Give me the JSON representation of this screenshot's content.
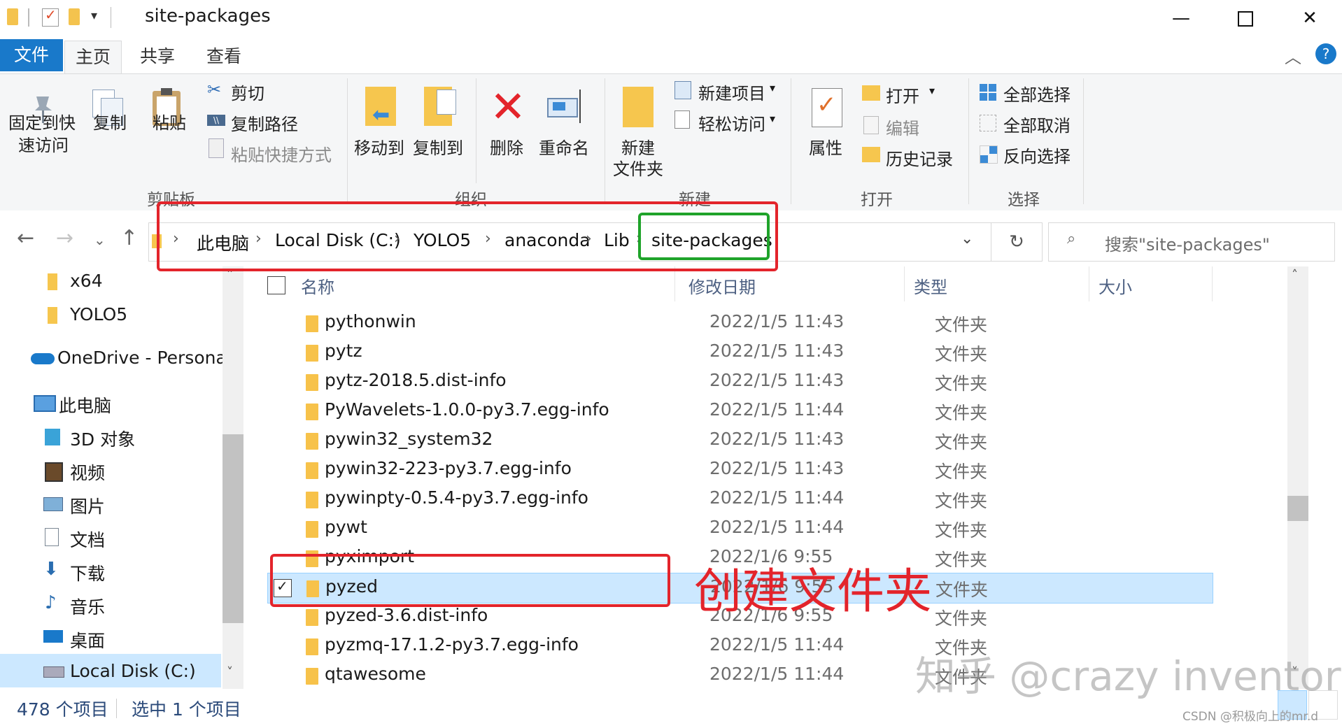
{
  "window": {
    "title": "site-packages",
    "minimize_icon": "minimize-icon",
    "maximize_icon": "maximize-icon",
    "close_icon": "close-icon"
  },
  "ribbon_tabs": [
    "文件",
    "主页",
    "共享",
    "查看"
  ],
  "ribbon": {
    "clipboard": {
      "pin_label_1": "固定到快",
      "pin_label_2": "速访问",
      "copy": "复制",
      "paste": "粘贴",
      "cut": "剪切",
      "copy_path": "复制路径",
      "paste_shortcut": "粘贴快捷方式",
      "group": "剪贴板"
    },
    "organize": {
      "move_to": "移动到",
      "copy_to": "复制到",
      "delete": "删除",
      "rename": "重命名",
      "group": "组织"
    },
    "new": {
      "new_folder_1": "新建",
      "new_folder_2": "文件夹",
      "new_item": "新建项目",
      "easy_access": "轻松访问",
      "group": "新建"
    },
    "open": {
      "properties": "属性",
      "open": "打开",
      "edit": "编辑",
      "history": "历史记录",
      "group": "打开"
    },
    "select": {
      "select_all": "全部选择",
      "select_none": "全部取消",
      "invert": "反向选择",
      "group": "选择"
    }
  },
  "address": {
    "crumbs": [
      "此电脑",
      "Local Disk (C:)",
      "YOLO5",
      "anaconda",
      "Lib",
      "site-packages"
    ],
    "search_placeholder": "搜索\"site-packages\""
  },
  "nav_pane": [
    {
      "label": "x64",
      "icon": "folder-icon"
    },
    {
      "label": "YOLO5",
      "icon": "folder-icon"
    },
    {
      "label": "OneDrive - Personal",
      "icon": "onedrive-icon"
    },
    {
      "label": "此电脑",
      "icon": "computer-icon"
    },
    {
      "label": "3D 对象",
      "icon": "3d-objects-icon"
    },
    {
      "label": "视频",
      "icon": "video-icon"
    },
    {
      "label": "图片",
      "icon": "pictures-icon"
    },
    {
      "label": "文档",
      "icon": "documents-icon"
    },
    {
      "label": "下载",
      "icon": "download-icon"
    },
    {
      "label": "音乐",
      "icon": "music-icon"
    },
    {
      "label": "桌面",
      "icon": "desktop-icon"
    },
    {
      "label": "Local Disk (C:)",
      "icon": "drive-icon"
    }
  ],
  "columns": [
    "名称",
    "修改日期",
    "类型",
    "大小"
  ],
  "files": [
    {
      "name": "pythonwin",
      "date": "2022/1/5 11:43",
      "type": "文件夹"
    },
    {
      "name": "pytz",
      "date": "2022/1/5 11:43",
      "type": "文件夹"
    },
    {
      "name": "pytz-2018.5.dist-info",
      "date": "2022/1/5 11:43",
      "type": "文件夹"
    },
    {
      "name": "PyWavelets-1.0.0-py3.7.egg-info",
      "date": "2022/1/5 11:44",
      "type": "文件夹"
    },
    {
      "name": "pywin32_system32",
      "date": "2022/1/5 11:43",
      "type": "文件夹"
    },
    {
      "name": "pywin32-223-py3.7.egg-info",
      "date": "2022/1/5 11:43",
      "type": "文件夹"
    },
    {
      "name": "pywinpty-0.5.4-py3.7.egg-info",
      "date": "2022/1/5 11:44",
      "type": "文件夹"
    },
    {
      "name": "pywt",
      "date": "2022/1/5 11:44",
      "type": "文件夹"
    },
    {
      "name": "pyximport",
      "date": "2022/1/6 9:55",
      "type": "文件夹"
    },
    {
      "name": "pyzed",
      "date": "2022/1/6 9:55",
      "type": "文件夹",
      "selected": true
    },
    {
      "name": "pyzed-3.6.dist-info",
      "date": "2022/1/6 9:55",
      "type": "文件夹"
    },
    {
      "name": "pyzmq-17.1.2-py3.7.egg-info",
      "date": "2022/1/5 11:44",
      "type": "文件夹"
    },
    {
      "name": "qtawesome",
      "date": "2022/1/5 11:44",
      "type": "文件夹"
    }
  ],
  "status": {
    "count": "478 个项目",
    "selected": "选中 1 个项目"
  },
  "annotation": {
    "text": "创建文件夹",
    "color": "#e3242b",
    "highlight_color": "#1fa32a"
  },
  "watermark": {
    "main": "知乎 @crazy inventor",
    "small": "CSDN @积极向上的mr.d"
  }
}
